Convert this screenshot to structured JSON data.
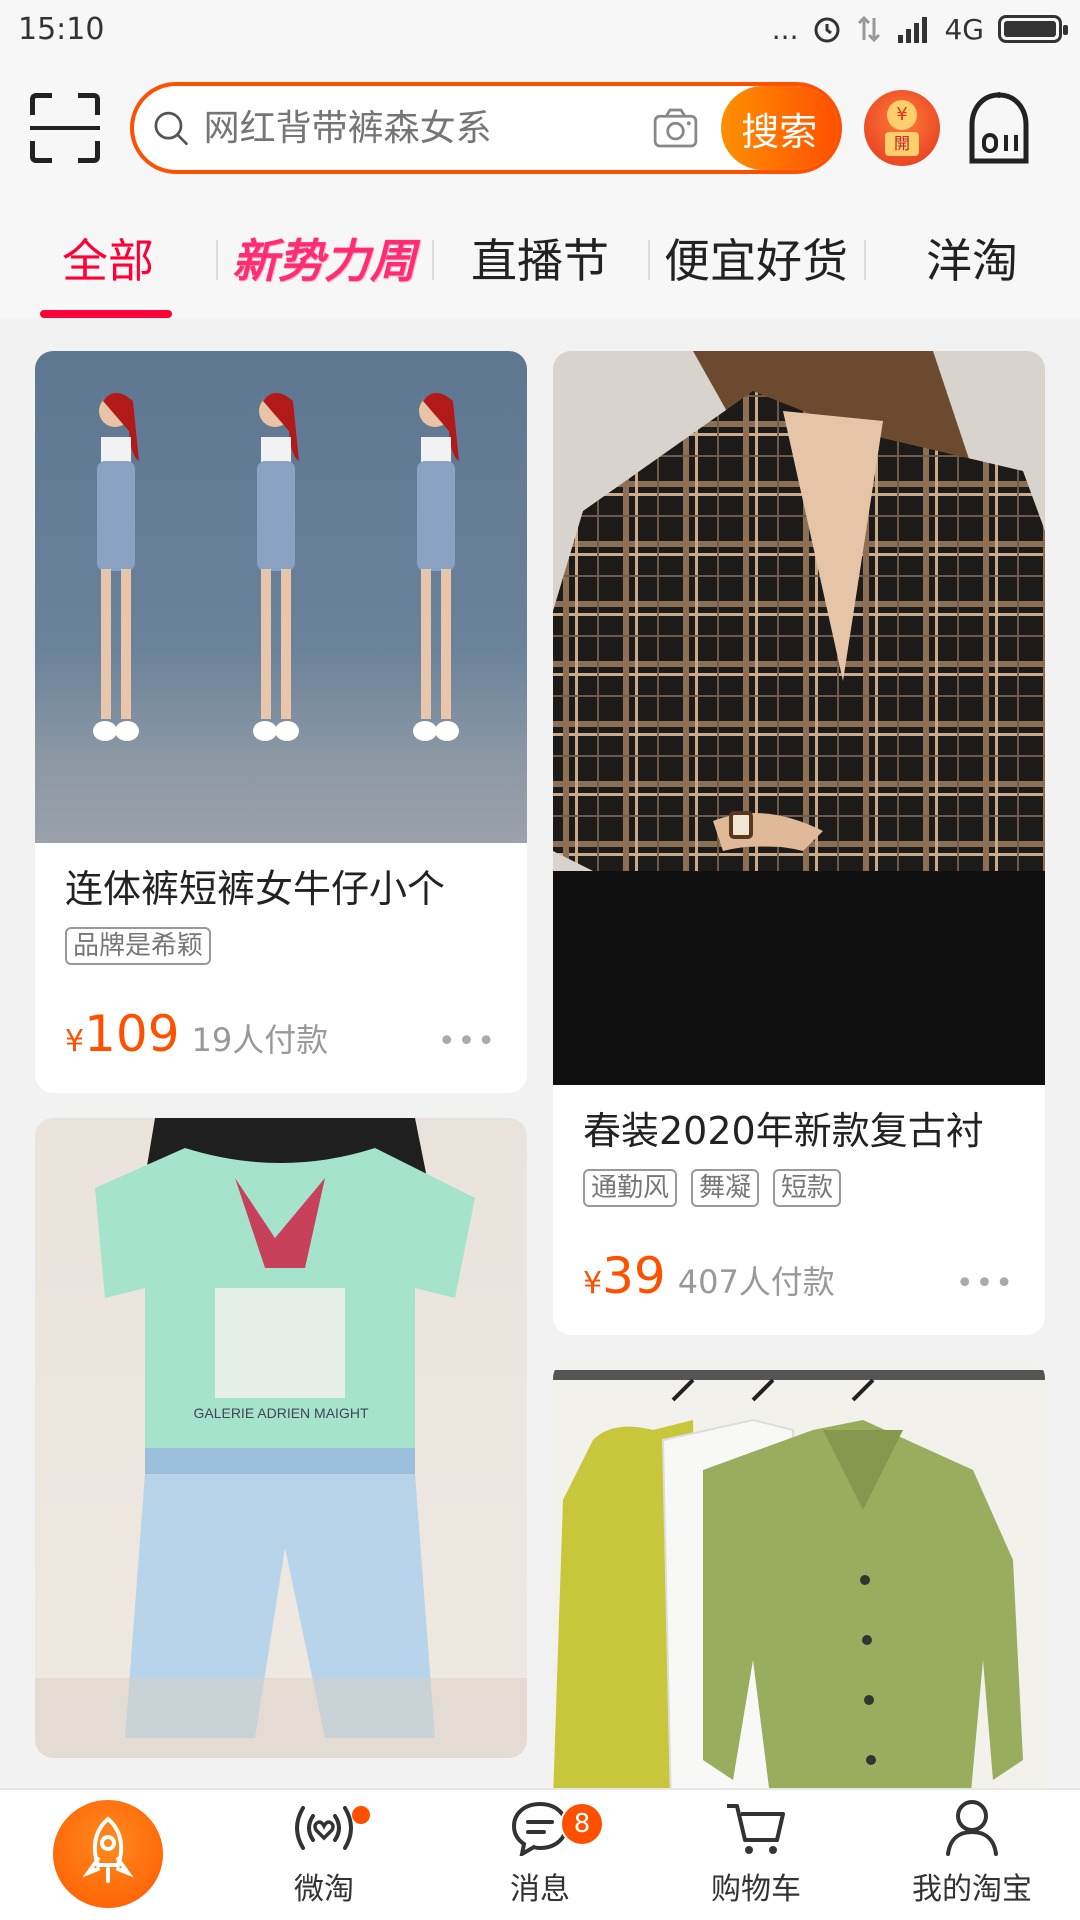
{
  "status_bar": {
    "time": "15:10",
    "signal_dots": "...",
    "network": "4G"
  },
  "search": {
    "placeholder": "网红背带裤森女系",
    "button_label": "搜索"
  },
  "redpacket": {
    "coin": "¥",
    "tag": "開"
  },
  "tabs": [
    {
      "label": "全部",
      "active": true
    },
    {
      "label": "新势力周",
      "active": false
    },
    {
      "label": "直播节",
      "active": false
    },
    {
      "label": "便宜好货",
      "active": false
    },
    {
      "label": "洋淘",
      "active": false
    }
  ],
  "products": [
    {
      "title": "连体裤短裤女牛仔小个",
      "tags": [
        "品牌是希颖"
      ],
      "currency": "¥",
      "price": "109",
      "sold": "19人付款",
      "image_icon": "denim-overalls-photo"
    },
    {
      "title": "春装2020年新款复古衬",
      "tags": [
        "通勤风",
        "舞凝",
        "短款"
      ],
      "currency": "¥",
      "price": "39",
      "sold": "407人付款",
      "image_icon": "plaid-shirt-photo"
    },
    {
      "title": "",
      "image_icon": "mint-tshirt-photo"
    },
    {
      "title": "",
      "image_icon": "satin-blouses-photo"
    }
  ],
  "bottom_nav": [
    {
      "label": "",
      "icon": "rocket-icon"
    },
    {
      "label": "微淘",
      "icon": "weitao-icon"
    },
    {
      "label": "消息",
      "icon": "message-icon",
      "badge": "8"
    },
    {
      "label": "购物车",
      "icon": "cart-icon"
    },
    {
      "label": "我的淘宝",
      "icon": "profile-icon"
    }
  ],
  "colors": {
    "brand_orange": "#ff5000",
    "active_tab_red": "#ff0036",
    "promo_pink": "#ff2d6f"
  }
}
